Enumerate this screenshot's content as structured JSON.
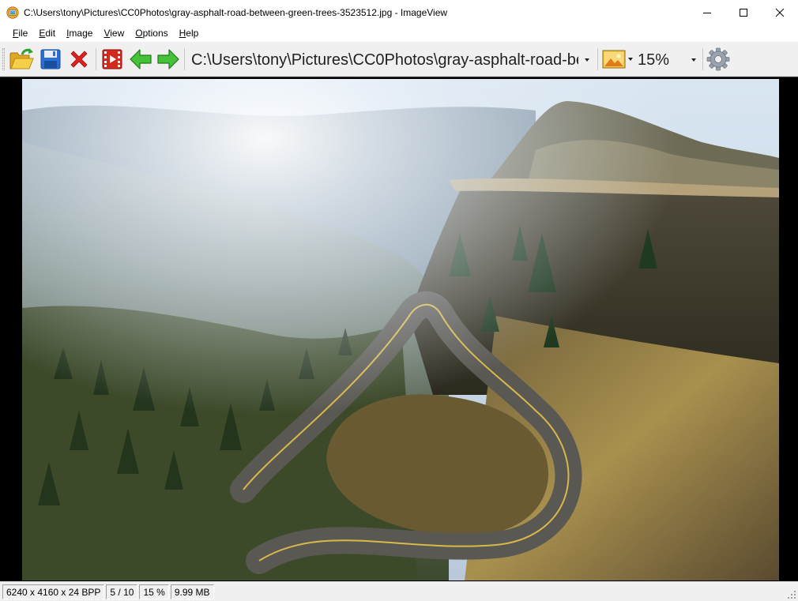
{
  "window": {
    "title": "C:\\Users\\tony\\Pictures\\CC0Photos\\gray-asphalt-road-between-green-trees-3523512.jpg - ImageView",
    "app_icon": "imageview-app-icon",
    "controls": [
      "minimize-icon",
      "maximize-icon",
      "close-icon"
    ]
  },
  "menu": {
    "items": [
      {
        "label": "File",
        "underline": "F"
      },
      {
        "label": "Edit",
        "underline": "E"
      },
      {
        "label": "Image",
        "underline": "I"
      },
      {
        "label": "View",
        "underline": "V"
      },
      {
        "label": "Options",
        "underline": "O"
      },
      {
        "label": "Help",
        "underline": "H"
      }
    ]
  },
  "toolbar": {
    "buttons": [
      "open-folder-icon",
      "save-disk-icon",
      "delete-x-icon",
      "slideshow-film-icon",
      "previous-arrow-icon",
      "next-arrow-icon",
      "image-type-icon",
      "settings-gear-icon"
    ],
    "path_value": "C:\\Users\\tony\\Pictures\\CC0Photos\\gray-asphalt-road-between-green-trees-3523512.jpg",
    "zoom_value": "15%"
  },
  "status": {
    "dimensions": "6240 x 4160 x 24 BPP",
    "position": "5 / 10",
    "zoom": "15 %",
    "size": "9.99 MB"
  },
  "colors": {
    "accent_green": "#2ea12e",
    "delete_red": "#e02020",
    "folder_yellow": "#f2c233",
    "save_blue": "#2a6fd6"
  }
}
